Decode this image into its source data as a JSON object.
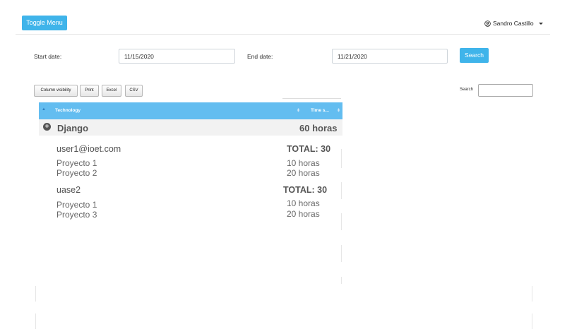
{
  "header": {
    "toggle_label": "Toggle Menu",
    "user_name": "Sandro Castillo"
  },
  "filters": {
    "start_label": "Start date:",
    "start_value": "11/15/2020",
    "end_label": "End date:",
    "end_value": "11/21/2020",
    "search_label": "Search"
  },
  "table_tools": {
    "buttons": [
      "Column visibility",
      "Print",
      "Excel",
      "CSV"
    ],
    "search_label": "Search",
    "search_value": ""
  },
  "table": {
    "columns": [
      "Technology",
      "Time s..."
    ],
    "group": {
      "name": "Django",
      "total": "60 horas"
    },
    "users": [
      {
        "name": "user1@ioet.com",
        "total": "TOTAL: 30",
        "projects": [
          {
            "name": "Proyecto 1",
            "hours": "10 horas"
          },
          {
            "name": "Proyecto 2",
            "hours": "20 horas"
          }
        ]
      },
      {
        "name": "uase2",
        "total": "TOTAL: 30",
        "projects": [
          {
            "name": "Proyecto 1",
            "hours": "10 horas"
          },
          {
            "name": "Proyecto 3",
            "hours": "20 horas"
          }
        ]
      }
    ]
  },
  "colors": {
    "accent": "#3fb4ea",
    "table_header": "#63bdf0",
    "group_row": "#f2f2f2"
  },
  "icons": {
    "user": "user-circle-icon",
    "dropdown": "caret-down-icon",
    "expand": "plus-circle-icon",
    "sort": "sort-icon"
  }
}
